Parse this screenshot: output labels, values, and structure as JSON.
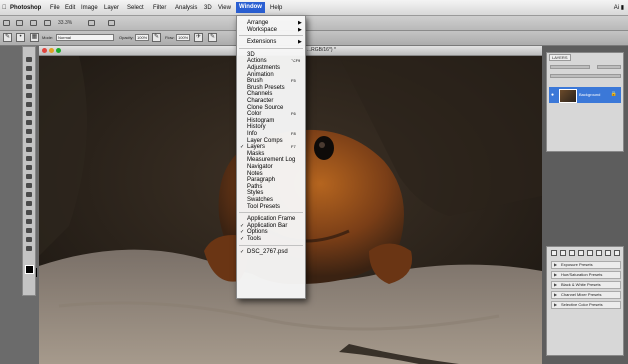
{
  "menubar": {
    "app": "Photoshop",
    "items": [
      "File",
      "Edit",
      "Image",
      "Layer",
      "Select",
      "Filter",
      "Analysis",
      "3D",
      "View",
      "Window",
      "Help"
    ],
    "active": "Window",
    "right_text": "Ai ▮"
  },
  "appbar": {
    "zoom_value": "33.3%"
  },
  "options": {
    "mode_label": "Mode:",
    "mode_value": "Normal",
    "opacity_label": "Opacity:",
    "opacity_value": "100%",
    "flow_label": "Flow:",
    "flow_value": "100%"
  },
  "document": {
    "title": "...RGB/16*) *"
  },
  "layers_panel": {
    "tab_label": "LAYERS",
    "blend_mode": "Normal",
    "opacity": "100%",
    "layer_name": "Background"
  },
  "adjustments_panel": {
    "presets": [
      "Exposure Presets",
      "Hue/Saturation Presets",
      "Black & White Presets",
      "Channel Mixer Presets",
      "Selective Color Presets"
    ]
  },
  "window_menu": {
    "groups": [
      [
        {
          "label": "Arrange",
          "submenu": true
        },
        {
          "label": "Workspace",
          "submenu": true
        }
      ],
      [
        {
          "label": "Extensions",
          "submenu": true
        }
      ],
      [
        {
          "label": "3D"
        },
        {
          "label": "Actions",
          "shortcut": "⌥F9"
        },
        {
          "label": "Adjustments"
        },
        {
          "label": "Animation"
        },
        {
          "label": "Brush",
          "shortcut": "F5"
        },
        {
          "label": "Brush Presets"
        },
        {
          "label": "Channels"
        },
        {
          "label": "Character"
        },
        {
          "label": "Clone Source"
        },
        {
          "label": "Color",
          "shortcut": "F6"
        },
        {
          "label": "Histogram"
        },
        {
          "label": "History"
        },
        {
          "label": "Info",
          "shortcut": "F8"
        },
        {
          "label": "Layer Comps"
        },
        {
          "label": "Layers",
          "shortcut": "F7",
          "checked": true
        },
        {
          "label": "Masks"
        },
        {
          "label": "Measurement Log"
        },
        {
          "label": "Navigator"
        },
        {
          "label": "Notes"
        },
        {
          "label": "Paragraph"
        },
        {
          "label": "Paths"
        },
        {
          "label": "Styles"
        },
        {
          "label": "Swatches"
        },
        {
          "label": "Tool Presets"
        }
      ],
      [
        {
          "label": "Application Frame"
        },
        {
          "label": "Application Bar",
          "checked": true
        },
        {
          "label": "Options",
          "checked": true
        },
        {
          "label": "Tools",
          "checked": true
        }
      ],
      [
        {
          "label": "DSC_2767.psd",
          "checked": true
        }
      ]
    ]
  }
}
